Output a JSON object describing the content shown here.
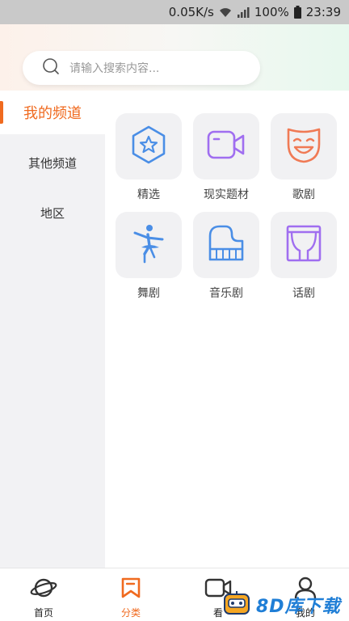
{
  "status_bar": {
    "speed": "0.05K/s",
    "battery": "100%",
    "time": "23:39"
  },
  "search": {
    "placeholder": "请输入搜索内容..."
  },
  "sidebar": {
    "items": [
      {
        "label": "我的频道",
        "active": true
      },
      {
        "label": "其他频道",
        "active": false
      },
      {
        "label": "地区",
        "active": false
      }
    ]
  },
  "channels": [
    {
      "label": "精选",
      "icon": "star-badge-icon"
    },
    {
      "label": "现实题材",
      "icon": "video-camera-icon"
    },
    {
      "label": "歌剧",
      "icon": "opera-mask-icon"
    },
    {
      "label": "舞剧",
      "icon": "ballet-dancer-icon"
    },
    {
      "label": "音乐剧",
      "icon": "piano-icon"
    },
    {
      "label": "话剧",
      "icon": "stage-curtain-icon"
    }
  ],
  "tabbar": {
    "items": [
      {
        "label": "首页",
        "icon": "planet-icon",
        "active": false
      },
      {
        "label": "分类",
        "icon": "bookmark-icon",
        "active": true
      },
      {
        "label": "看",
        "icon": "video-icon",
        "active": false
      },
      {
        "label": "我的",
        "icon": "user-icon",
        "active": false
      }
    ]
  },
  "watermark": {
    "text": "8D库下载"
  },
  "colors": {
    "accent": "#f06a1f",
    "icon_blue": "#4a8ee6",
    "icon_purple": "#a06ef0",
    "icon_orange": "#f07a55"
  }
}
